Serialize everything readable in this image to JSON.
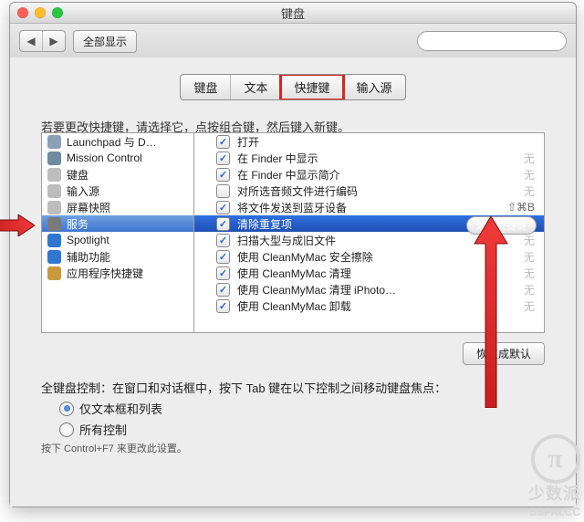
{
  "window": {
    "title": "键盘"
  },
  "toolbar": {
    "show_all": "全部显示",
    "search_placeholder": ""
  },
  "tabs": {
    "items": [
      "键盘",
      "文本",
      "快捷键",
      "输入源"
    ],
    "activeIndex": 2
  },
  "instruction": "若要更改快捷键，请选择它，点按组合键，然后键入新键。",
  "categories": [
    {
      "icon": "launchpad",
      "label": "Launchpad 与 D…"
    },
    {
      "icon": "mission",
      "label": "Mission Control"
    },
    {
      "icon": "keyboard",
      "label": "键盘"
    },
    {
      "icon": "input",
      "label": "输入源"
    },
    {
      "icon": "screenshot",
      "label": "屏幕快照"
    },
    {
      "icon": "services",
      "label": "服务",
      "selected": true
    },
    {
      "icon": "spotlight",
      "label": "Spotlight"
    },
    {
      "icon": "a11y",
      "label": "辅助功能"
    },
    {
      "icon": "app",
      "label": "应用程序快捷键"
    }
  ],
  "shortcuts": [
    {
      "checked": true,
      "label": "打开",
      "shortcut": ""
    },
    {
      "checked": true,
      "label": "在 Finder 中显示",
      "shortcut": "无"
    },
    {
      "checked": true,
      "label": "在 Finder 中显示简介",
      "shortcut": "无"
    },
    {
      "checked": false,
      "label": "对所选音频文件进行编码",
      "shortcut": "无"
    },
    {
      "checked": true,
      "label": "将文件发送到蓝牙设备",
      "shortcut": "⇧⌘B"
    },
    {
      "checked": true,
      "label": "清除重复项",
      "selected": true,
      "addBtn": "添加快捷键"
    },
    {
      "checked": true,
      "label": "扫描大型与成旧文件",
      "shortcut": "无"
    },
    {
      "checked": true,
      "label": "使用 CleanMyMac 安全擦除",
      "shortcut": "无"
    },
    {
      "checked": true,
      "label": "使用 CleanMyMac 清理",
      "shortcut": "无"
    },
    {
      "checked": true,
      "label": "使用 CleanMyMac 清理 iPhoto…",
      "shortcut": "无"
    },
    {
      "checked": true,
      "label": "使用 CleanMyMac 卸载",
      "shortcut": "无"
    }
  ],
  "restore_defaults": "恢复成默认",
  "full_keyboard": {
    "prompt": "全键盘控制：在窗口和对话框中，按下 Tab 键在以下控制之间移动键盘焦点：",
    "opt1": "仅文本框和列表",
    "opt2": "所有控制",
    "hint": "按下 Control+F7 来更改此设置。"
  },
  "watermark": {
    "brand1": "少数派",
    "brand2": "SSPAI.CC"
  }
}
